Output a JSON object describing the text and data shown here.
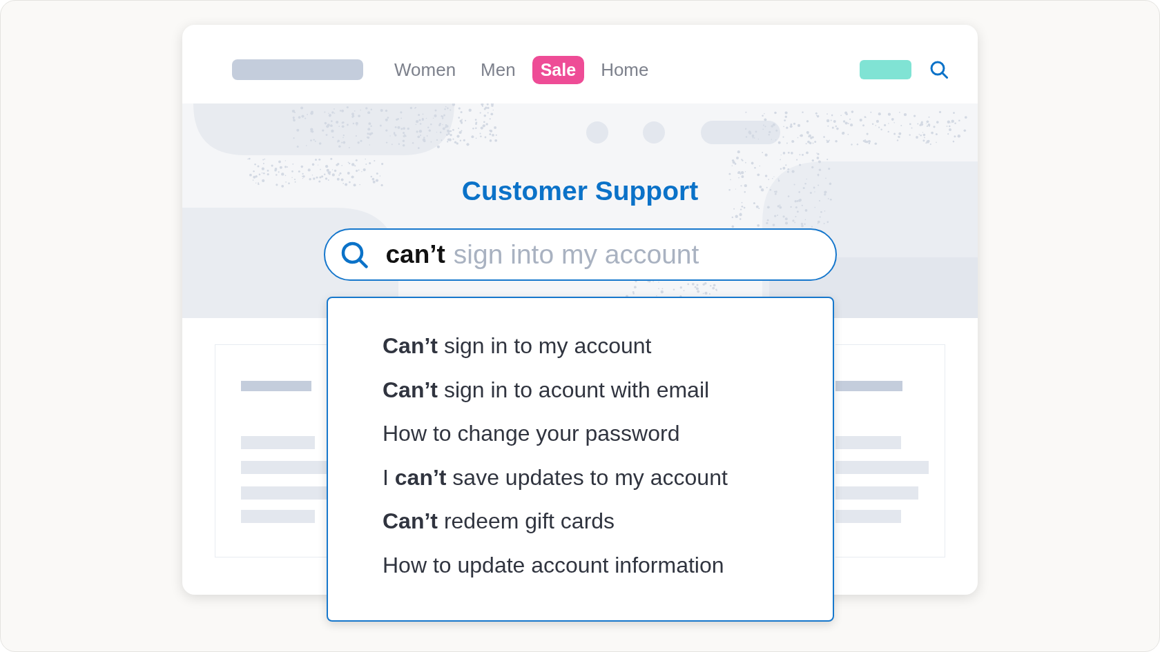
{
  "nav": {
    "items": [
      {
        "label": "Women",
        "highlighted": false
      },
      {
        "label": "Men",
        "highlighted": false
      },
      {
        "label": "Sale",
        "highlighted": true
      },
      {
        "label": "Home",
        "highlighted": false
      }
    ]
  },
  "hero": {
    "title": "Customer Support"
  },
  "search": {
    "value": "can’t",
    "completion": "sign into my account"
  },
  "suggestions": [
    "**Can’t** sign in to my account",
    "**Can’t** sign in to acount with email",
    "How to change your password",
    "I **can’t** save updates to my account",
    "**Can’t** redeem gift cards",
    "How to update account information"
  ]
}
